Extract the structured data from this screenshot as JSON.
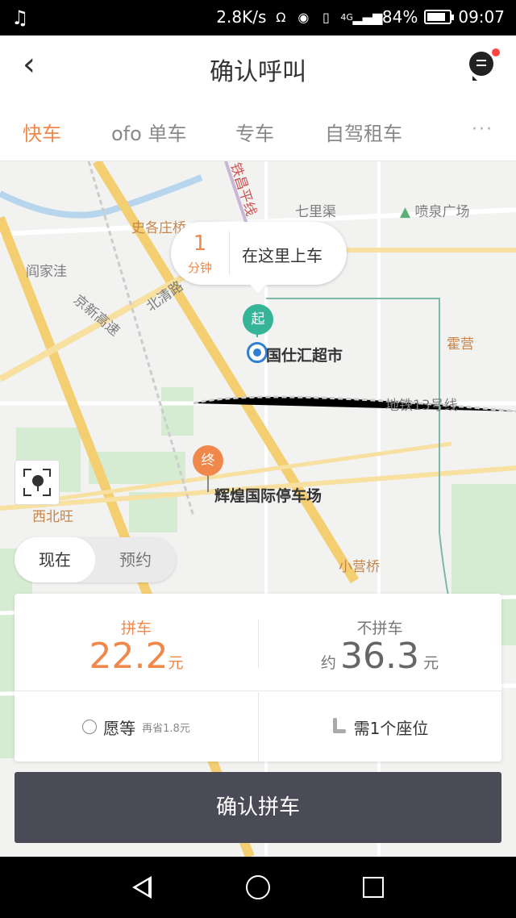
{
  "status_bar": {
    "network_speed": "2.8K/s",
    "network_type": "4G",
    "battery": "84%",
    "battery_level": 0.84,
    "time": "09:07",
    "icons": [
      "music-note-icon",
      "headset-icon",
      "location-icon",
      "vibrate-icon",
      "signal-icon",
      "battery-icon"
    ]
  },
  "header": {
    "title": "确认呼叫",
    "back_icon": "chevron-left-icon",
    "message_icon": "message-bubble-icon"
  },
  "tabs": {
    "items": [
      {
        "label": "快车",
        "active": true
      },
      {
        "label": "ofo 单车",
        "active": false
      },
      {
        "label": "专车",
        "active": false
      },
      {
        "label": "自驾租车",
        "active": false
      }
    ],
    "more_label": "···",
    "accent_color": "#f0884b"
  },
  "map": {
    "eta": {
      "value": "1",
      "unit": "分钟",
      "text": "在这里上车"
    },
    "start_pin": "起",
    "end_pin": "终",
    "start_name": "国仕汇超市",
    "end_name": "辉煌国际停车场",
    "labels": {
      "shigezhuangqiao": "史各庄桥",
      "qiliqu": "七里渠",
      "penquan": "喷泉广场",
      "yanjiawa": "阎家洼",
      "jingxin": "京新高速",
      "beiqing": "北清路",
      "huoying": "霍营",
      "metro13": "地铁13号线",
      "changping": "铁昌平线",
      "xibeiwang": "西北旺",
      "xiaoyingqiao": "小营桥"
    },
    "locate_icon": "locate-target-icon"
  },
  "time_toggle": {
    "now": "现在",
    "reserve": "预约"
  },
  "pricing": {
    "pool": {
      "title": "拼车",
      "price": "22.2",
      "unit": "元"
    },
    "no_pool": {
      "title": "不拼车",
      "prefix": "约",
      "price": "36.3",
      "unit": "元"
    },
    "wait": {
      "label": "愿等",
      "saving": "再省1.8元"
    },
    "seats": {
      "label": "需1个座位",
      "icon": "seat-icon"
    }
  },
  "confirm_button": "确认拼车",
  "nav": {
    "back_icon": "triangle-back-icon",
    "home_icon": "circle-home-icon",
    "recent_icon": "square-recent-icon"
  }
}
